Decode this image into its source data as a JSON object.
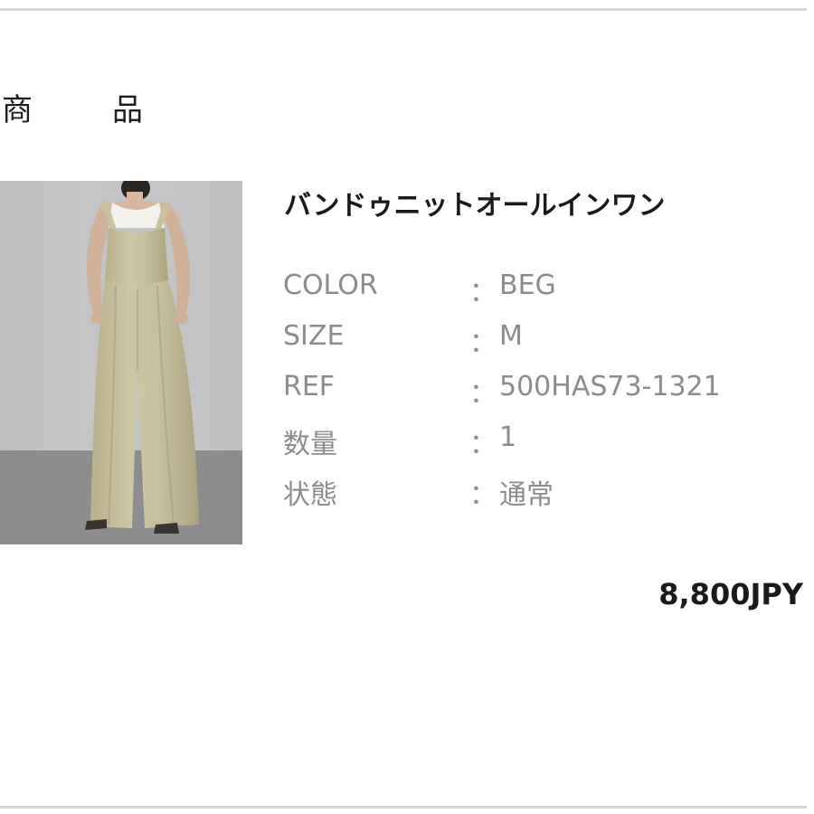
{
  "section": {
    "heading_char1": "商",
    "heading_char2": "品"
  },
  "product": {
    "image_icon": "product-photo-jumpsuit",
    "name": "バンドゥニットオールインワン",
    "specs": [
      {
        "label": "COLOR",
        "colon": "：",
        "value": "BEG"
      },
      {
        "label": "SIZE",
        "colon": "：",
        "value": "M"
      },
      {
        "label": "REF",
        "colon": "：",
        "value": "500HAS73-1321"
      },
      {
        "label": "数量",
        "colon": "：",
        "value": "1"
      },
      {
        "label": "状態",
        "colon": "：",
        "value": "通常"
      }
    ],
    "price": "8,800JPY"
  },
  "colors": {
    "rule": "#d6d6d6",
    "spec_text": "#8c8c8c",
    "strong_text": "#1a1a1a",
    "garment_beige": "#c9c39f"
  }
}
